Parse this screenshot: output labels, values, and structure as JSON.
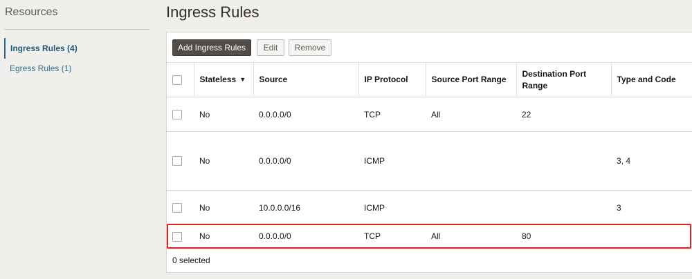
{
  "sidebar": {
    "title": "Resources",
    "items": [
      {
        "label": "Ingress Rules (4)"
      },
      {
        "label": "Egress Rules (1)"
      }
    ]
  },
  "page": {
    "title": "Ingress Rules"
  },
  "toolbar": {
    "add_label": "Add Ingress Rules",
    "edit_label": "Edit",
    "remove_label": "Remove"
  },
  "table": {
    "columns": {
      "stateless": "Stateless",
      "source": "Source",
      "ip_protocol": "IP Protocol",
      "source_port_range": "Source Port Range",
      "destination_port_range": "Destination Port Range",
      "type_and_code": "Type and Code"
    },
    "rows": [
      {
        "stateless": "No",
        "source": "0.0.0.0/0",
        "ip_protocol": "TCP",
        "source_port_range": "All",
        "destination_port_range": "22",
        "type_and_code": ""
      },
      {
        "stateless": "No",
        "source": "0.0.0.0/0",
        "ip_protocol": "ICMP",
        "source_port_range": "",
        "destination_port_range": "",
        "type_and_code": "3, 4"
      },
      {
        "stateless": "No",
        "source": "10.0.0.0/16",
        "ip_protocol": "ICMP",
        "source_port_range": "",
        "destination_port_range": "",
        "type_and_code": "3"
      },
      {
        "stateless": "No",
        "source": "0.0.0.0/0",
        "ip_protocol": "TCP",
        "source_port_range": "All",
        "destination_port_range": "80",
        "type_and_code": ""
      }
    ]
  },
  "footer": {
    "selected_text": "0 selected"
  },
  "colors": {
    "accent": "#2b6a8a",
    "primary_button": "#514c47",
    "highlight": "#e02424"
  },
  "icons": {
    "sort": "sort-down-icon"
  }
}
